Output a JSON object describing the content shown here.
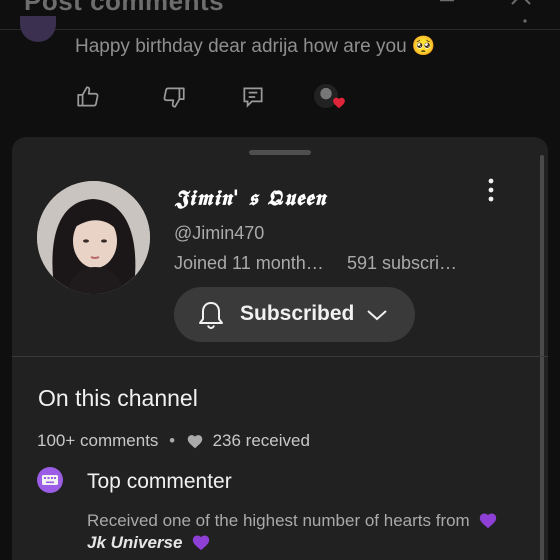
{
  "header": {
    "title": "Post comments",
    "filter_icon": "filter-icon",
    "close_icon": "close-icon"
  },
  "comment": {
    "text": "Happy birthday dear adrija how are you 🥺",
    "actions": [
      "like-icon",
      "dislike-icon",
      "reply-icon",
      "creator-heart-icon"
    ]
  },
  "profile_sheet": {
    "channel_name": "𝕵𝖎𝖒𝖎𝖓' 𝖘 𝕼𝖚𝖊𝖊𝖓",
    "handle": "@Jimin470",
    "joined": "Joined 11 month…",
    "subscribers": "591 subscri…",
    "subscribe_button": {
      "label": "Subscribed",
      "icon": "bell-icon",
      "dropdown_icon": "chevron-down-icon"
    },
    "on_this_channel": {
      "title": "On this channel",
      "comments": "100+ comments",
      "separator": "•",
      "hearts": "236 received",
      "badge": {
        "icon": "keyboard-icon",
        "title": "Top commenter",
        "description": "Received one of the highest number of hearts from",
        "channel": "Jk Universe"
      }
    }
  },
  "colors": {
    "background": "#0f0f0f",
    "sheet": "#212121",
    "button": "#3a3a3a",
    "accent_purple": "#9b5de5",
    "heart_red": "#e0243a"
  }
}
